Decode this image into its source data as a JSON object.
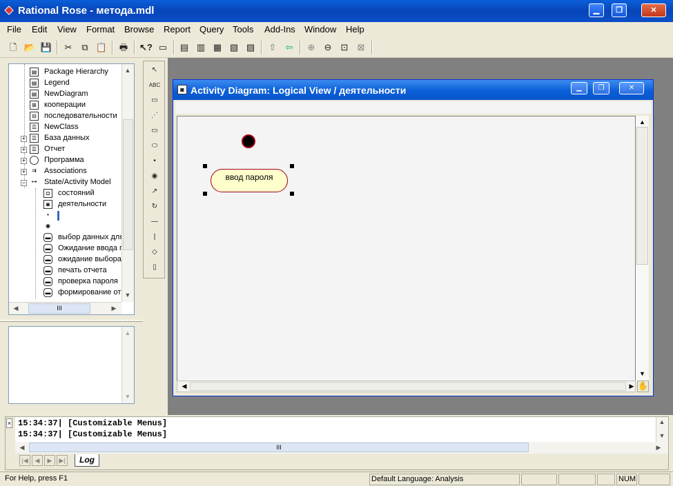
{
  "app": {
    "title": "Rational Rose - метода.mdl"
  },
  "menu": [
    "File",
    "Edit",
    "View",
    "Format",
    "Browse",
    "Report",
    "Query",
    "Tools",
    "Add-Ins",
    "Window",
    "Help"
  ],
  "toolbar": {
    "icons": [
      "new-icon",
      "open-icon",
      "save-icon",
      "cut-icon",
      "copy-icon",
      "paste-icon",
      "print-icon",
      "context-help-icon",
      "view-doc-icon",
      "browse-class-icon",
      "browse-interaction-icon",
      "browse-component-icon",
      "browse-deployment-icon",
      "browse-statechart-icon",
      "browse-parent-icon",
      "browse-previous-icon",
      "zoom-in-icon",
      "zoom-out-icon",
      "fit-in-window-icon",
      "undo-fit-icon"
    ]
  },
  "tree": {
    "items": [
      {
        "label": "Package Hierarchy",
        "icon": "diagram-icon"
      },
      {
        "label": "Legend",
        "icon": "diagram-icon"
      },
      {
        "label": "NewDiagram",
        "icon": "diagram-icon"
      },
      {
        "label": "кооперации",
        "icon": "collaboration-diagram-icon"
      },
      {
        "label": "последовательности",
        "icon": "sequence-diagram-icon"
      },
      {
        "label": "NewClass",
        "icon": "class-icon"
      },
      {
        "label": "База данных",
        "icon": "class-icon"
      },
      {
        "label": "Отчет",
        "icon": "class-icon"
      },
      {
        "label": "Программа",
        "icon": "control-class-icon"
      },
      {
        "label": "Associations",
        "icon": "association-icon"
      },
      {
        "label": "State/Activity Model",
        "icon": "state-model-icon"
      },
      {
        "label": "состояний",
        "icon": "statechart-diagram-icon"
      },
      {
        "label": "деятельности",
        "icon": "activity-diagram-icon"
      },
      {
        "label": "",
        "icon": "start-state-icon"
      },
      {
        "label": "",
        "icon": "end-state-icon"
      },
      {
        "label": "выбор данных для",
        "icon": "activity-icon"
      },
      {
        "label": "Ожидание ввода п",
        "icon": "activity-icon"
      },
      {
        "label": "ожидание выбора",
        "icon": "activity-icon"
      },
      {
        "label": "печать отчета",
        "icon": "activity-icon"
      },
      {
        "label": "проверка пароля",
        "icon": "activity-icon"
      },
      {
        "label": "формирование от",
        "icon": "activity-icon"
      }
    ]
  },
  "palette": {
    "icons": [
      "selection-arrow-icon",
      "text-box-icon",
      "note-icon",
      "anchor-note-icon",
      "state-icon",
      "activity-icon",
      "start-state-icon",
      "end-state-icon",
      "state-transition-icon",
      "transition-to-self-icon",
      "horizontal-sync-icon",
      "vertical-sync-icon",
      "decision-icon",
      "swimlane-icon"
    ],
    "text_label": "ABC"
  },
  "diagram": {
    "title": "Activity Diagram: Logical View / деятельности",
    "activity_label": "ввод пароля"
  },
  "log": {
    "lines": [
      "15:34:37|  [Customizable Menus]",
      "15:34:37|  [Customizable Menus]"
    ],
    "tab": "Log"
  },
  "status": {
    "help": "For Help, press F1",
    "language": "Default Language: Analysis",
    "num": "NUM"
  },
  "scroll": {
    "grip": "III"
  },
  "colors": {
    "activity_fill": "#ffffcc",
    "activity_border": "#a0001a",
    "title_blue": "#0a5fd8"
  }
}
